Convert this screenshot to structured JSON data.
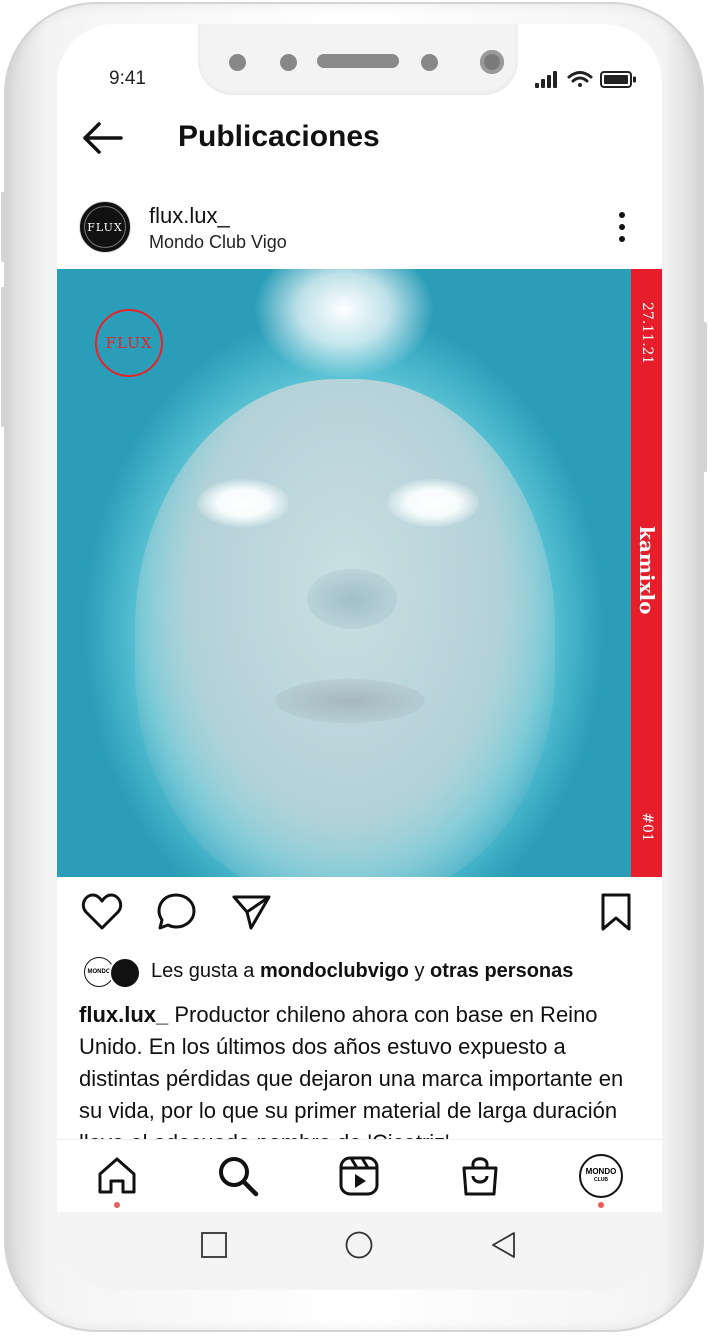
{
  "status_bar": {
    "time": "9:41"
  },
  "header": {
    "title": "Publicaciones"
  },
  "post": {
    "username": "flux.lux_",
    "location": "Mondo Club Vigo",
    "avatar_text": "FLUX",
    "image": {
      "logo_text": "FLUX",
      "strip_date": "27.11.21",
      "strip_name": "kamixlo",
      "strip_number": "#01",
      "strip_color": "#e61e2b"
    },
    "likes": {
      "prefix": "Les gusta a",
      "user": "mondoclubvigo",
      "joiner": "y",
      "others": "otras personas",
      "avatar_text": "MONDO"
    },
    "caption": {
      "username": "flux.lux_",
      "text": "Productor chileno ahora con base en Reino Unido. En los últimos dos años estuvo expuesto a distintas pérdidas que dejaron una marca importante en su vida, por lo que su primer material de larga duración lleva el adecuado nombre de 'Cicatriz'."
    }
  },
  "tabbar": {
    "profile_text": "MONDO",
    "profile_subtext": "CLUB",
    "indicator_color": "#ec5c5c"
  }
}
